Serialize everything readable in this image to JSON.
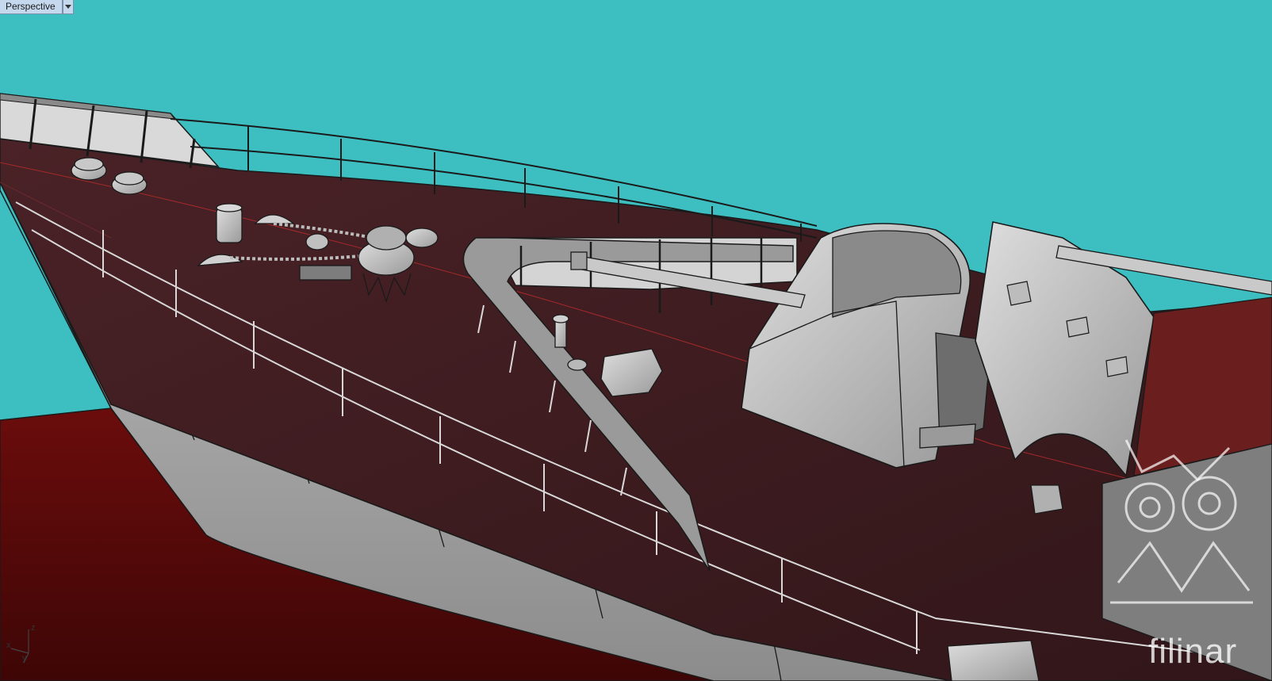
{
  "viewport": {
    "label": "Perspective",
    "menu_icon": "triangle-down-icon",
    "background_color": "#3dbfc2"
  },
  "axes": {
    "x": "x",
    "y": "y",
    "z": "z"
  },
  "watermark": {
    "text": "filinar"
  },
  "colors": {
    "deck": "#3b1c1f",
    "hull_red": "#5e0b0b",
    "hull_grey": "#a9a9a9",
    "structure_grey": "#c9c9c9",
    "line": "#1a1a1a"
  }
}
